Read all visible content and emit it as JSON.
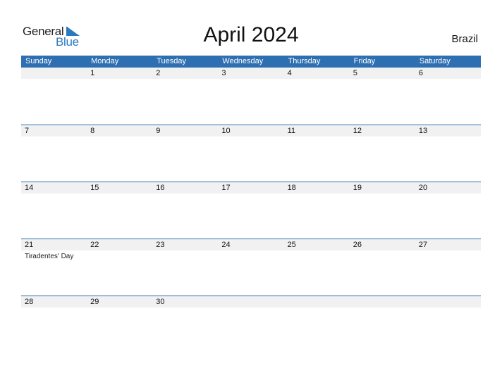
{
  "logo": {
    "text_top": "General",
    "text_bottom": "Blue",
    "icon": "triangle-flag-icon"
  },
  "title": "April 2024",
  "country": "Brazil",
  "colors": {
    "accent": "#2d6fb0",
    "logo_blue": "#2a7ac0",
    "date_strip": "#f1f1f1"
  },
  "weekdays": [
    "Sunday",
    "Monday",
    "Tuesday",
    "Wednesday",
    "Thursday",
    "Friday",
    "Saturday"
  ],
  "weeks": [
    {
      "days": [
        {
          "num": "",
          "event": ""
        },
        {
          "num": "1",
          "event": ""
        },
        {
          "num": "2",
          "event": ""
        },
        {
          "num": "3",
          "event": ""
        },
        {
          "num": "4",
          "event": ""
        },
        {
          "num": "5",
          "event": ""
        },
        {
          "num": "6",
          "event": ""
        }
      ]
    },
    {
      "days": [
        {
          "num": "7",
          "event": ""
        },
        {
          "num": "8",
          "event": ""
        },
        {
          "num": "9",
          "event": ""
        },
        {
          "num": "10",
          "event": ""
        },
        {
          "num": "11",
          "event": ""
        },
        {
          "num": "12",
          "event": ""
        },
        {
          "num": "13",
          "event": ""
        }
      ]
    },
    {
      "days": [
        {
          "num": "14",
          "event": ""
        },
        {
          "num": "15",
          "event": ""
        },
        {
          "num": "16",
          "event": ""
        },
        {
          "num": "17",
          "event": ""
        },
        {
          "num": "18",
          "event": ""
        },
        {
          "num": "19",
          "event": ""
        },
        {
          "num": "20",
          "event": ""
        }
      ]
    },
    {
      "days": [
        {
          "num": "21",
          "event": "Tiradentes' Day"
        },
        {
          "num": "22",
          "event": ""
        },
        {
          "num": "23",
          "event": ""
        },
        {
          "num": "24",
          "event": ""
        },
        {
          "num": "25",
          "event": ""
        },
        {
          "num": "26",
          "event": ""
        },
        {
          "num": "27",
          "event": ""
        }
      ]
    },
    {
      "days": [
        {
          "num": "28",
          "event": ""
        },
        {
          "num": "29",
          "event": ""
        },
        {
          "num": "30",
          "event": ""
        },
        {
          "num": "",
          "event": ""
        },
        {
          "num": "",
          "event": ""
        },
        {
          "num": "",
          "event": ""
        },
        {
          "num": "",
          "event": ""
        }
      ]
    }
  ]
}
